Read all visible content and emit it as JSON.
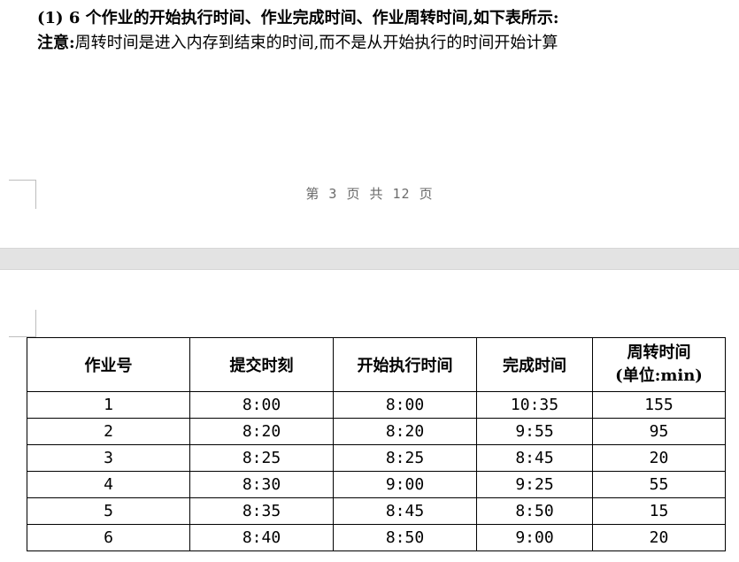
{
  "page1": {
    "heading": "(1) 6 个作业的开始执行时间、作业完成时间、作业周转时间,如下表所示:",
    "note_label": "注意:",
    "note_text": "周转时间是进入内存到结束的时间,而不是从开始执行的时间开始计算",
    "footer": "第 3 页 共 12 页"
  },
  "table": {
    "headers": [
      "作业号",
      "提交时刻",
      "开始执行时间",
      "完成时间",
      "周转时间"
    ],
    "header_unit": "(单位:min)",
    "rows": [
      [
        "1",
        "8:00",
        "8:00",
        "10:35",
        "155"
      ],
      [
        "2",
        "8:20",
        "8:20",
        "9:55",
        "95"
      ],
      [
        "3",
        "8:25",
        "8:25",
        "8:45",
        "20"
      ],
      [
        "4",
        "8:30",
        "9:00",
        "9:25",
        "55"
      ],
      [
        "5",
        "8:35",
        "8:45",
        "8:50",
        "15"
      ],
      [
        "6",
        "8:40",
        "8:50",
        "9:00",
        "20"
      ]
    ]
  }
}
